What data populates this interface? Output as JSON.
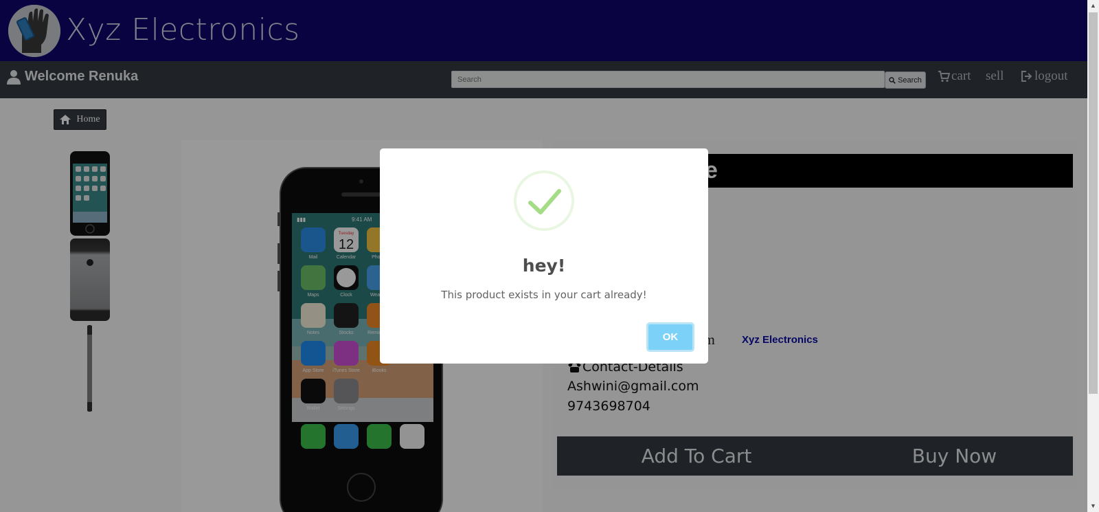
{
  "header": {
    "brand": "Xyz Electronics",
    "logo_icon": "hand-holding-phone-icon"
  },
  "navbar": {
    "welcome": "Welcome Renuka",
    "search_placeholder": "Search",
    "search_button": "Search",
    "cart": "cart",
    "sell": "sell",
    "logout": "logout"
  },
  "breadcrumb": {
    "home": "Home"
  },
  "product": {
    "title_partial": "e",
    "seller_partial": "om",
    "seller_link": "Xyz Electronics",
    "contact_heading": "Contact-Details",
    "email": "Ashwini@gmail.com",
    "phone": "9743698704",
    "add_to_cart": "Add To Cart",
    "buy_now": "Buy Now"
  },
  "phone_screen": {
    "time": "9:41 AM",
    "calendar_day": "Tuesday",
    "calendar_date": "12",
    "apps": [
      "Mail",
      "Calendar",
      "Photos",
      "Maps",
      "Clock",
      "Weather",
      "Notes",
      "Stocks",
      "Reminders",
      "App Store",
      "iTunes Store",
      "iBooks",
      "Wallet",
      "Settings"
    ]
  },
  "modal": {
    "title": "hey!",
    "message": "This product exists in your cart already!",
    "ok": "OK"
  },
  "colors": {
    "brand_bar": "#11066e",
    "navbar": "#343a40",
    "ok_button": "#7cd1f9",
    "success_check": "#a5dc86"
  }
}
